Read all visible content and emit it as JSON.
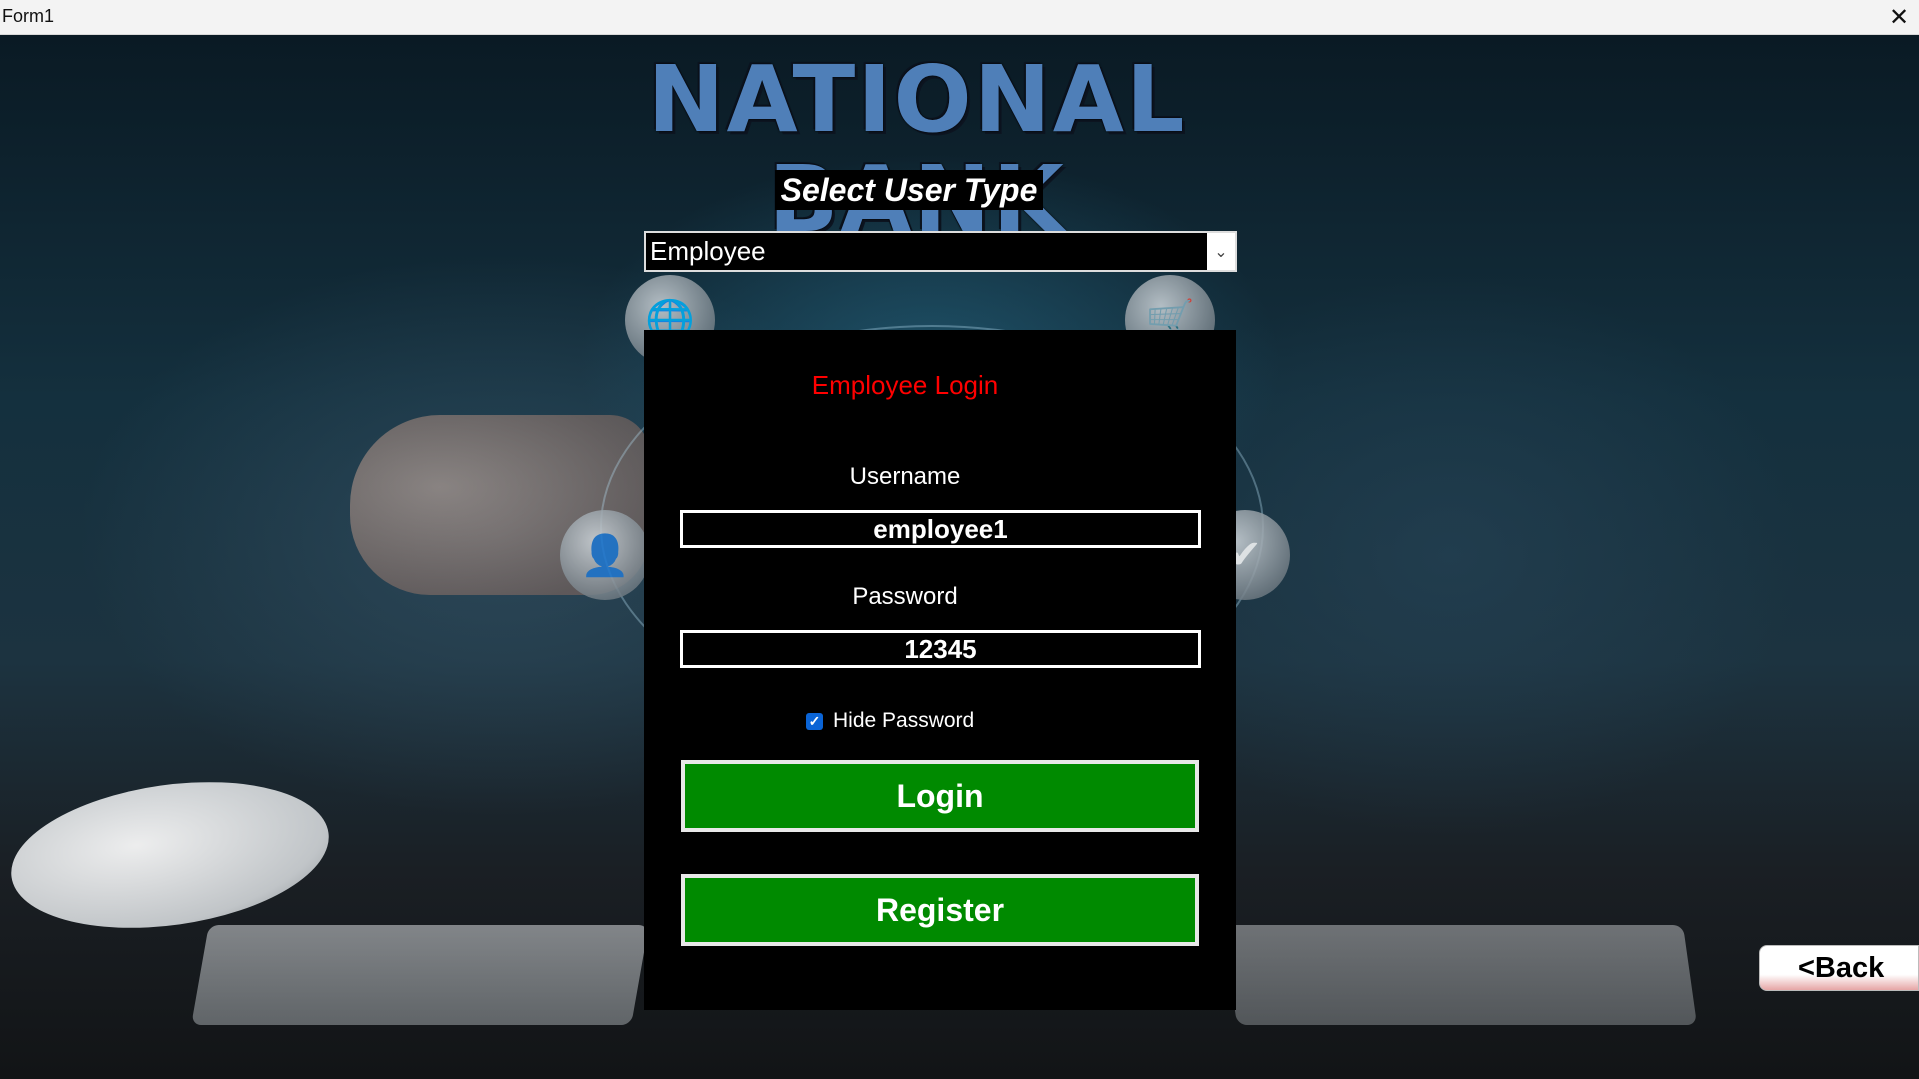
{
  "window": {
    "title": "Form1",
    "close_icon": "close-icon"
  },
  "header": {
    "brand": "NATIONAL BANK",
    "select_label": "Select User Type"
  },
  "user_type": {
    "selected": "Employee"
  },
  "login": {
    "title": "Employee Login",
    "username_label": "Username",
    "username_value": "employee1",
    "password_label": "Password",
    "password_value": "12345",
    "hide_password_label": "Hide Password",
    "hide_password_checked": true,
    "login_button": "Login",
    "register_button": "Register"
  },
  "nav": {
    "back_button": "<Back"
  },
  "colors": {
    "panel_bg": "#000000",
    "title_red": "#ff0000",
    "button_green": "#008a00",
    "checkbox_blue": "#0a64d6"
  }
}
